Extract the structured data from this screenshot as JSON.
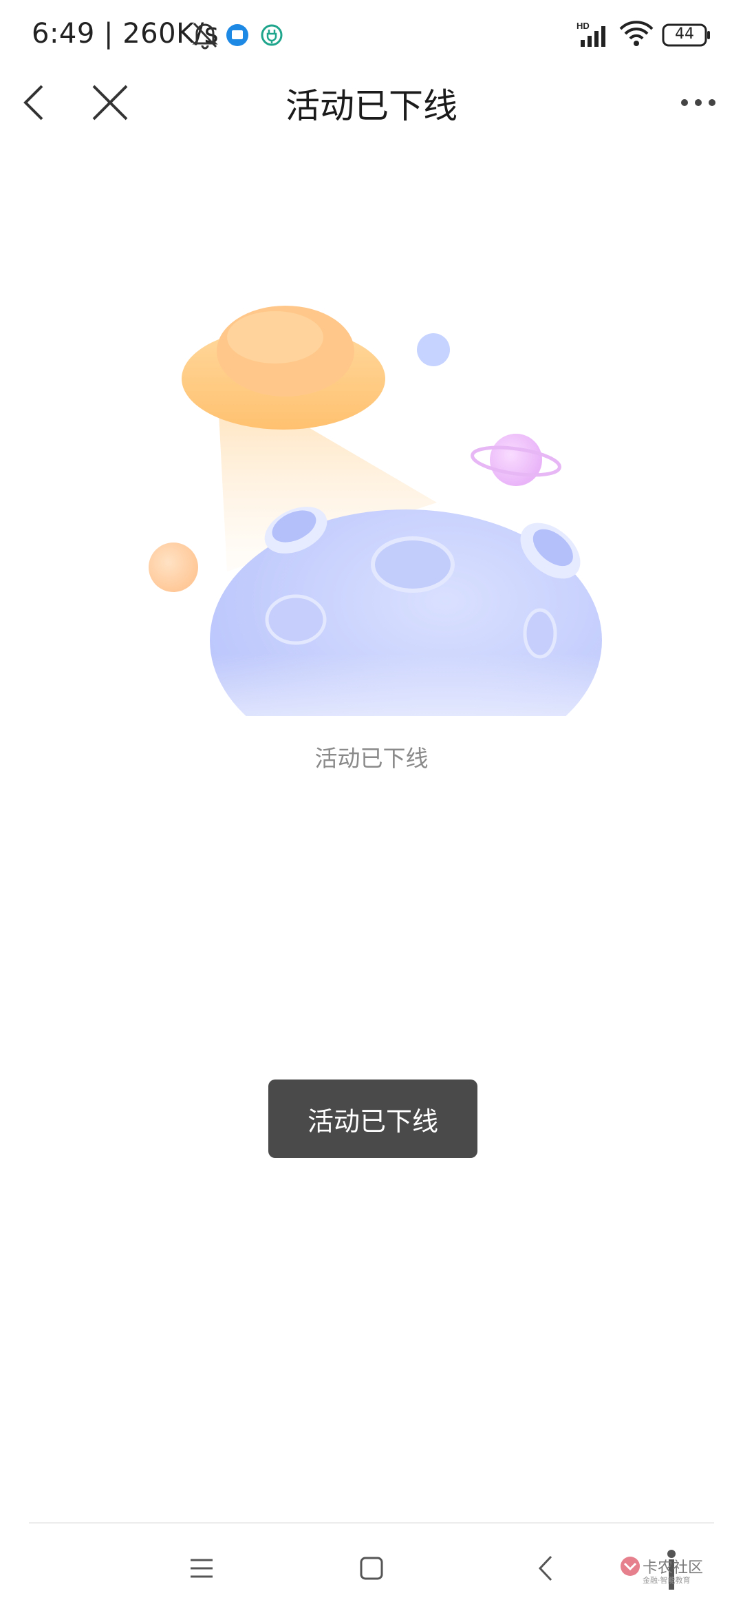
{
  "status_bar": {
    "time_speed": "6:49 | 260K/s",
    "network_label": "HD",
    "battery": "44"
  },
  "nav": {
    "title": "活动已下线"
  },
  "content": {
    "empty_text": "活动已下线"
  },
  "toast": {
    "text": "活动已下线"
  },
  "watermark": {
    "text": "卡农社区",
    "subtext": "金融·智能教育"
  },
  "colors": {
    "toast_bg": "#4a4a4a",
    "empty_text": "#8a8a8a",
    "planet": "#c9d3fb",
    "ufo": "#ffcf8a"
  }
}
